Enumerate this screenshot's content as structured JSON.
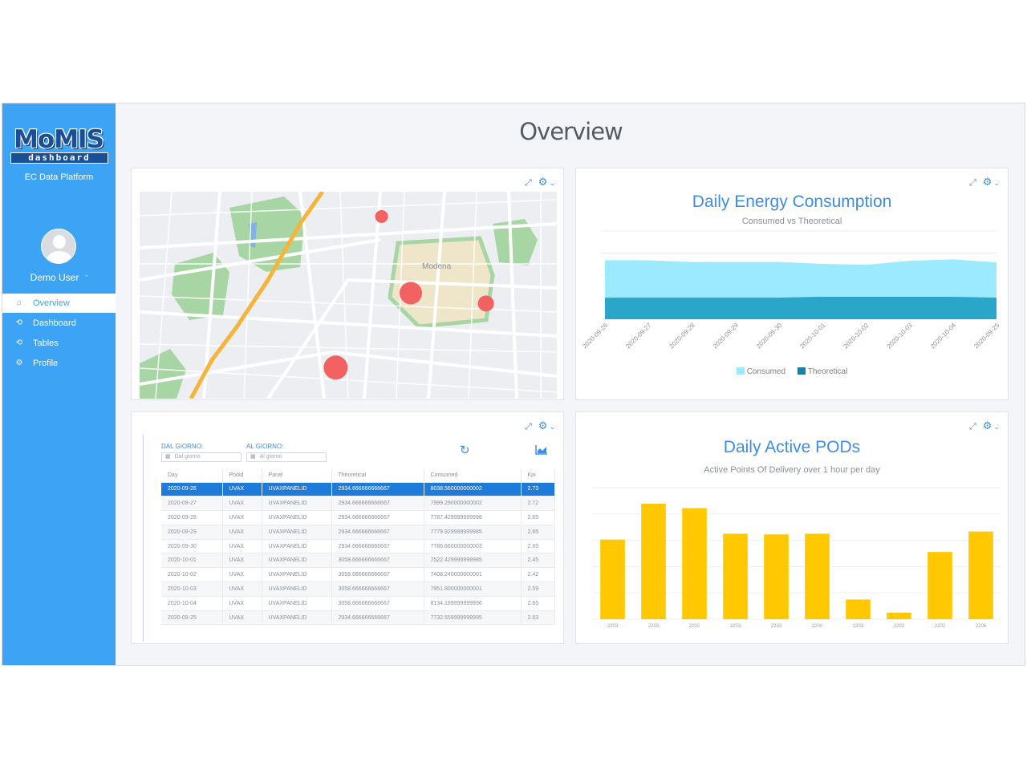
{
  "app": {
    "logo_main": "MoMIS",
    "logo_sub": "dashboard",
    "platform": "EC Data Platform",
    "user": "Demo User"
  },
  "sidebar": {
    "items": [
      {
        "label": "Overview",
        "icon": "home-icon",
        "active": true
      },
      {
        "label": "Dashboard",
        "icon": "history-icon",
        "active": false
      },
      {
        "label": "Tables",
        "icon": "history-icon",
        "active": false
      },
      {
        "label": "Profile",
        "icon": "gear-icon",
        "active": false
      }
    ]
  },
  "page": {
    "title": "Overview"
  },
  "map": {
    "place_label": "Modena",
    "markers": [
      {
        "x": 0.58,
        "y": 0.12,
        "r": 8
      },
      {
        "x": 0.65,
        "y": 0.49,
        "r": 14
      },
      {
        "x": 0.83,
        "y": 0.54,
        "r": 10
      },
      {
        "x": 0.47,
        "y": 0.85,
        "r": 15
      }
    ],
    "marker_color": "#f36262"
  },
  "energy_chart": {
    "title": "Daily Energy Consumption",
    "subtitle": "Consumed vs Theoretical",
    "legend": [
      "Consumed",
      "Theoretical"
    ],
    "colors": {
      "consumed": "#9beaff",
      "theoretical": "#2aa7c8"
    }
  },
  "pods_chart": {
    "title": "Daily Active PODs",
    "subtitle": "Active Points Of Delivery over 1 hour per day",
    "color": "#ffc800"
  },
  "table_panel": {
    "from_label": "DAL GIORNO:",
    "to_label": "AL GIORNO:",
    "from_placeholder": "Dal giorno",
    "to_placeholder": "Al giorno",
    "columns": [
      "Day",
      "Podid",
      "Panel",
      "Theoretical",
      "Consumed",
      "Kpi"
    ],
    "rows": [
      [
        "2020-09-26",
        "UVAX",
        "UVAXPANELID",
        "2934.666666666667",
        "8038.560000000002",
        "2.73"
      ],
      [
        "2020-09-27",
        "UVAX",
        "UVAXPANELID",
        "2934.666666666667",
        "7999.290000000002",
        "2.72"
      ],
      [
        "2020-09-28",
        "UVAX",
        "UVAXPANELID",
        "2934.666666666667",
        "7787.429999999998",
        "2.65"
      ],
      [
        "2020-09-29",
        "UVAX",
        "UVAXPANELID",
        "2934.666666666667",
        "7779.929999999985",
        "2.65"
      ],
      [
        "2020-09-30",
        "UVAX",
        "UVAXPANELID",
        "2934.666666666667",
        "7786.660000000003",
        "2.65"
      ],
      [
        "2020-10-01",
        "UVAX",
        "UVAXPANELID",
        "3058.666666666667",
        "7522.429999999985",
        "2.45"
      ],
      [
        "2020-10-02",
        "UVAX",
        "UVAXPANELID",
        "3058.666666666667",
        "7408.240000000001",
        "2.42"
      ],
      [
        "2020-10-03",
        "UVAX",
        "UVAXPANELID",
        "3058.666666666667",
        "7951.800000000001",
        "2.59"
      ],
      [
        "2020-10-04",
        "UVAX",
        "UVAXPANELID",
        "3058.666666666667",
        "8134.189999999996",
        "2.65"
      ],
      [
        "2020-09-25",
        "UVAX",
        "UVAXPANELID",
        "2934.666666666667",
        "7732.559999999995",
        "2.63"
      ]
    ]
  },
  "chart_data": [
    {
      "type": "area",
      "title": "Daily Energy Consumption",
      "subtitle": "Consumed vs Theoretical",
      "categories": [
        "2020-09-26",
        "2020-09-27",
        "2020-09-28",
        "2020-09-29",
        "2020-09-30",
        "2020-10-01",
        "2020-10-02",
        "2020-10-03",
        "2020-10-04",
        "2020-09-25"
      ],
      "series": [
        {
          "name": "Consumed",
          "values": [
            8038.56,
            7999.29,
            7787.43,
            7779.93,
            7786.66,
            7522.43,
            7408.24,
            7951.8,
            8134.19,
            7732.56
          ]
        },
        {
          "name": "Theoretical",
          "values": [
            2934.67,
            2934.67,
            2934.67,
            2934.67,
            2934.67,
            3058.67,
            3058.67,
            3058.67,
            3058.67,
            2934.67
          ]
        }
      ],
      "ylim": [
        0,
        12000
      ],
      "grid": true,
      "legend": "bottom"
    },
    {
      "type": "bar",
      "title": "Daily Active PODs",
      "subtitle": "Active Points Of Delivery over 1 hour per day",
      "categories": [
        "2203",
        "2203",
        "2202",
        "2203",
        "2203",
        "2200",
        "2203",
        "2202",
        "2202",
        "2206"
      ],
      "values": [
        109,
        158,
        152,
        117,
        116,
        117,
        27,
        9,
        92,
        120
      ],
      "ylim": [
        0,
        180
      ],
      "grid": true
    }
  ]
}
